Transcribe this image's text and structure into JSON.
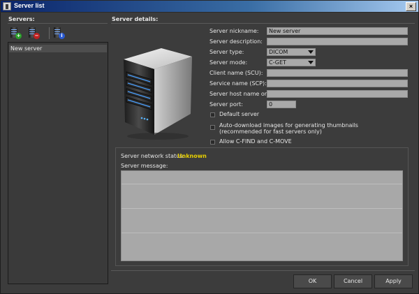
{
  "window": {
    "title": "Server list",
    "close_glyph": "×"
  },
  "servers": {
    "label": "Servers:",
    "toolbar": [
      {
        "name": "add-server-button",
        "icon": "server-add-icon",
        "glyph": "+"
      },
      {
        "name": "remove-server-button",
        "icon": "server-remove-icon",
        "glyph": "−"
      },
      {
        "name": "server-info-button",
        "icon": "server-info-icon",
        "glyph": "i"
      }
    ],
    "items": [
      "New server"
    ]
  },
  "details": {
    "label": "Server details:",
    "nickname_label": "Server nickname:",
    "nickname_value": "New server",
    "description_label": "Server description:",
    "description_value": "",
    "type_label": "Server type:",
    "type_value": "DICOM",
    "mode_label": "Server mode:",
    "mode_value": "C-GET",
    "client_label": "Client name (SCU):",
    "client_value": "",
    "service_label": "Service name (SCP):",
    "service_value": "",
    "host_label": "Server host name or IP:",
    "host_value": "",
    "port_label": "Server port:",
    "port_value": "0",
    "default_server_label": "Default server",
    "autodownload_label_1": "Auto-download images for generating thumbnails",
    "autodownload_label_2": "(recommended for fast servers only)",
    "allow_cfind_label": "Allow C-FIND and C-MOVE"
  },
  "status": {
    "network_label": "Server network status:",
    "network_value": "Unknown",
    "message_label": "Server message:",
    "message_value": "",
    "status_color": "#e8d000"
  },
  "buttons": {
    "ok": "OK",
    "cancel": "Cancel",
    "apply": "Apply"
  }
}
